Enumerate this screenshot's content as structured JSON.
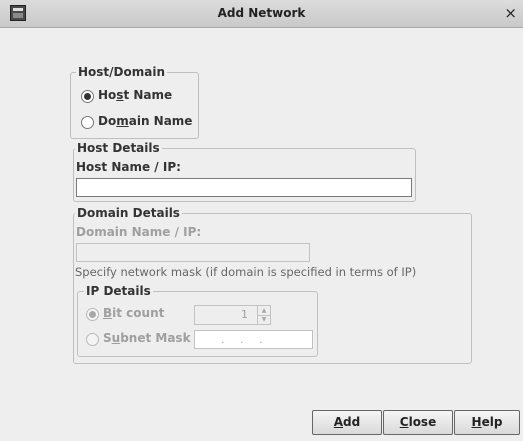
{
  "window": {
    "title": "Add Network",
    "close_glyph": "×"
  },
  "host_domain": {
    "legend": "Host/Domain",
    "options": [
      {
        "pre": "Ho",
        "mn": "s",
        "post": "t Name",
        "selected": true
      },
      {
        "pre": "Do",
        "mn": "m",
        "post": "ain Name",
        "selected": false
      }
    ]
  },
  "host_details": {
    "legend": "Host Details",
    "label": "Host Name / IP:",
    "value": ""
  },
  "domain_details": {
    "legend": "Domain Details",
    "label": "Domain Name / IP:",
    "value": "",
    "mask_note": "Specify network mask (if domain is specified in terms of IP)"
  },
  "ip_details": {
    "legend": "IP Details",
    "bit_count": {
      "mn": "B",
      "post": "it count",
      "selected": true,
      "value": "1"
    },
    "subnet_mask": {
      "pre": "S",
      "mn": "u",
      "post": "bnet Mask",
      "selected": false,
      "value": ". . ."
    }
  },
  "buttons": {
    "add": {
      "mn": "A",
      "post": "dd"
    },
    "close": {
      "mn": "C",
      "post": "lose"
    },
    "help": {
      "mn": "H",
      "post": "elp"
    }
  },
  "icons": [
    "app-window-icon",
    "close-icon",
    "spinner-up-icon",
    "spinner-down-icon"
  ]
}
